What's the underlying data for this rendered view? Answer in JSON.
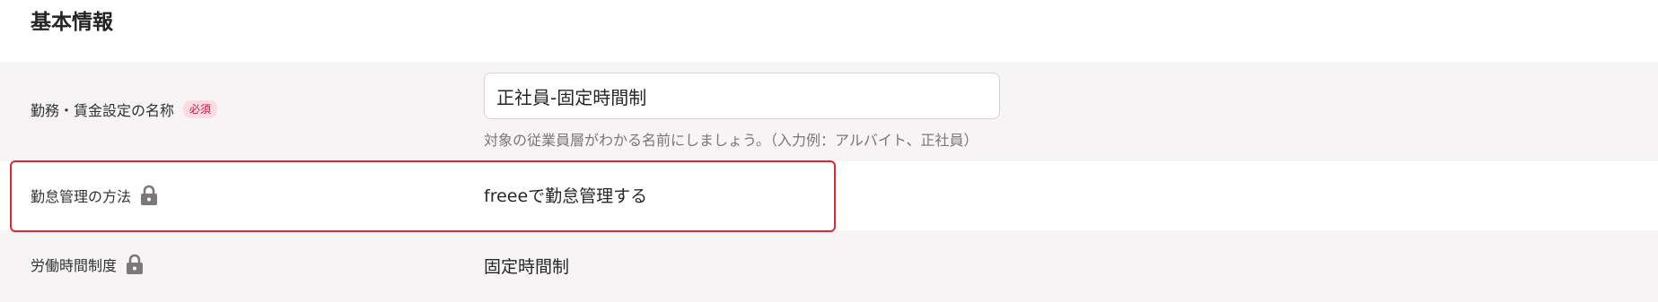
{
  "section": {
    "title": "基本情報"
  },
  "fields": {
    "name": {
      "label": "勤務・賃金設定の名称",
      "required_badge": "必須",
      "value": "正社員-固定時間制",
      "help_text": "対象の従業員層がわかる名前にしましょう。（入力例：アルバイト、正社員）"
    },
    "attendance_method": {
      "label": "勤怠管理の方法",
      "icon": "lock-icon",
      "value": "freeeで勤怠管理する"
    },
    "working_hours_system": {
      "label": "労働時間制度",
      "icon": "lock-icon",
      "value": "固定時間制"
    }
  },
  "colors": {
    "row_gray": "#f6f4f4",
    "required_badge_bg": "#fadbe1",
    "required_badge_text": "#c1204a",
    "highlight_border": "#e0262f",
    "lock_icon": "#7d7878"
  }
}
